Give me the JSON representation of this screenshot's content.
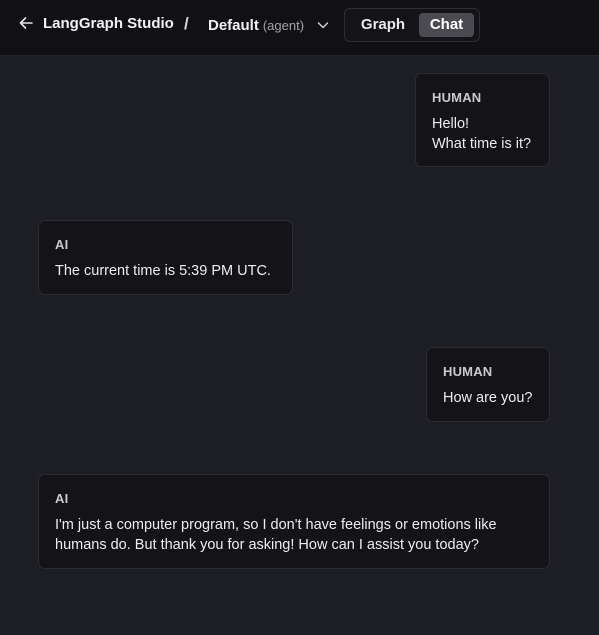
{
  "header": {
    "app_title": "LangGraph Studio",
    "separator": "/",
    "assistant": {
      "name": "Default",
      "sub": "(agent)"
    },
    "toggle": {
      "graph_label": "Graph",
      "chat_label": "Chat",
      "active": "Chat"
    }
  },
  "messages": [
    {
      "role": "HUMAN",
      "text": "Hello!\nWhat time is it?"
    },
    {
      "role": "AI",
      "text": "The current time is 5:39 PM UTC."
    },
    {
      "role": "HUMAN",
      "text": "How are you?"
    },
    {
      "role": "AI",
      "text": "I'm just a computer program, so I don't have feelings or emotions like\nhumans do. But thank you for asking! How can I assist you today?"
    }
  ],
  "icons": {
    "back": "arrow-left-icon",
    "dropdown": "chevron-down-icon"
  },
  "colors": {
    "background": "#1c1e23",
    "header": "#111114",
    "bubble": "#141418",
    "active_toggle": "#4a4a50"
  }
}
